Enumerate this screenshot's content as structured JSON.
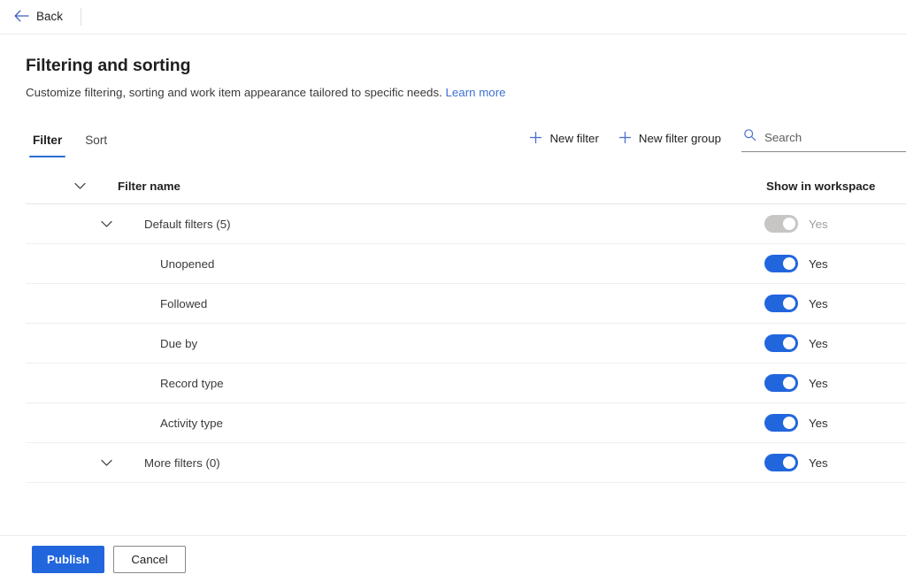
{
  "topbar": {
    "back_label": "Back",
    "back_icon": "arrow-left-icon"
  },
  "header": {
    "title": "Filtering and sorting",
    "subtitle": "Customize filtering, sorting and work item appearance tailored to specific needs.",
    "learn_more_label": "Learn more"
  },
  "tabs": [
    {
      "label": "Filter",
      "active": true
    },
    {
      "label": "Sort",
      "active": false
    }
  ],
  "toolbar": {
    "new_filter_label": "New filter",
    "new_filter_group_label": "New filter group",
    "add_icon": "plus-icon",
    "search_icon": "search-icon",
    "search_placeholder": "Search",
    "search_value": ""
  },
  "table": {
    "columns": {
      "name": "Filter name",
      "show_in_workspace": "Show in workspace"
    },
    "rows": [
      {
        "label": "Default filters (5)",
        "level": "group",
        "has_chevron": true,
        "toggle_on": true,
        "toggle_disabled": true,
        "toggle_label": "Yes"
      },
      {
        "label": "Unopened",
        "level": "child",
        "has_chevron": false,
        "toggle_on": true,
        "toggle_disabled": false,
        "toggle_label": "Yes"
      },
      {
        "label": "Followed",
        "level": "child",
        "has_chevron": false,
        "toggle_on": true,
        "toggle_disabled": false,
        "toggle_label": "Yes"
      },
      {
        "label": "Due by",
        "level": "child",
        "has_chevron": false,
        "toggle_on": true,
        "toggle_disabled": false,
        "toggle_label": "Yes"
      },
      {
        "label": "Record type",
        "level": "child",
        "has_chevron": false,
        "toggle_on": true,
        "toggle_disabled": false,
        "toggle_label": "Yes"
      },
      {
        "label": "Activity type",
        "level": "child",
        "has_chevron": false,
        "toggle_on": true,
        "toggle_disabled": false,
        "toggle_label": "Yes"
      },
      {
        "label": "More filters (0)",
        "level": "group",
        "has_chevron": true,
        "toggle_on": true,
        "toggle_disabled": false,
        "toggle_label": "Yes"
      }
    ]
  },
  "footer": {
    "publish_label": "Publish",
    "cancel_label": "Cancel"
  },
  "colors": {
    "accent": "#2266dd",
    "link": "#3b6fd4",
    "toggle_off": "#c8c6c4",
    "tab_underline": "#2b6cd4"
  }
}
